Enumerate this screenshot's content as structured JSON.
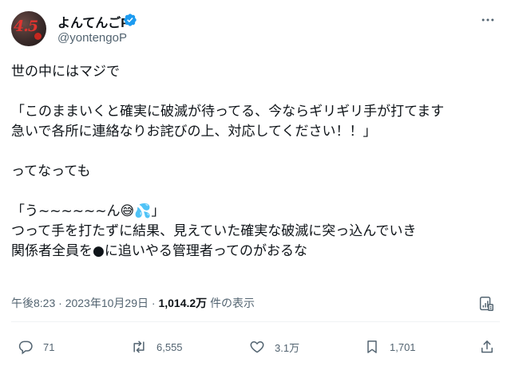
{
  "user": {
    "display_name": "よんてんごP",
    "handle": "@yontengoP",
    "avatar_text": "4.5",
    "verified": true
  },
  "tweet": {
    "lines": [
      "世の中にはマジで",
      "",
      "「このままいくと確実に破滅が待ってる、今ならギリギリ手が打てます",
      "急いで各所に連絡なりお詫びの上、対応してください！！」",
      "",
      "ってなっても",
      "",
      "「う~~~~~~ん😅💦」",
      "つって手を打たずに結果、見えていた確実な破滅に突っ込んでいき",
      "関係者全員を●に追いやる管理者ってのがおるな"
    ]
  },
  "meta": {
    "time": "午後8:23",
    "separator": "·",
    "date": "2023年10月29日",
    "views_count": "1,014.2万",
    "views_label": "件の表示"
  },
  "actions": {
    "replies": "71",
    "reposts": "6,555",
    "likes": "3.1万",
    "bookmarks": "1,701"
  },
  "colors": {
    "text": "#0f1419",
    "secondary": "#536471",
    "verified": "#1d9bf0",
    "divider": "#eff3f4"
  }
}
